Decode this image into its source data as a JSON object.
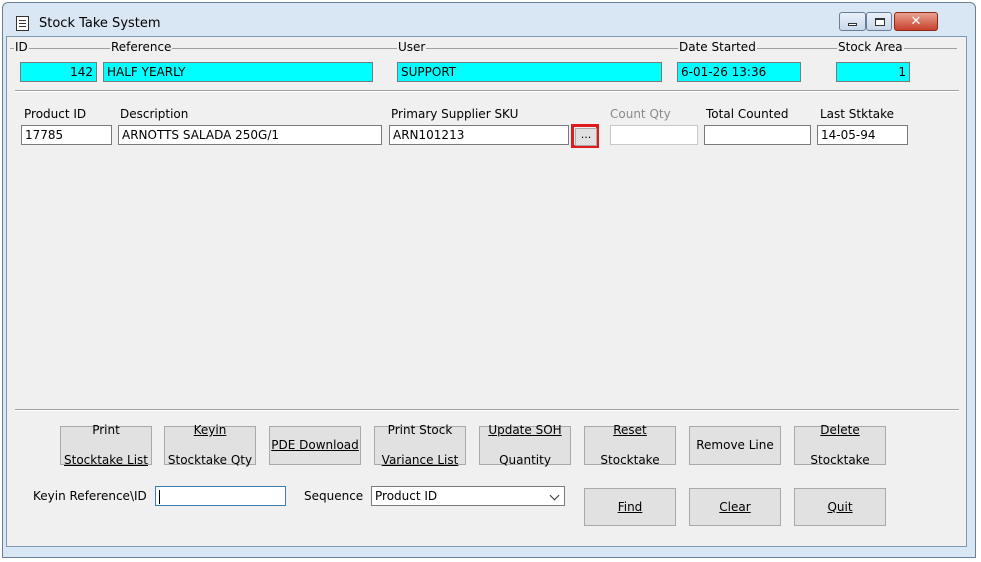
{
  "window": {
    "title": "Stock Take System"
  },
  "header": {
    "id_label": "ID",
    "id_value": "142",
    "reference_label": "Reference",
    "reference_value": "HALF YEARLY",
    "user_label": "User",
    "user_value": "SUPPORT",
    "date_label": "Date Started",
    "date_value": "6-01-26 13:36",
    "area_label": "Stock Area",
    "area_value": "1"
  },
  "line": {
    "product_id_label": "Product ID",
    "product_id_value": "17785",
    "description_label": "Description",
    "description_value": "ARNOTTS SALADA 250G/1",
    "sku_label": "Primary Supplier SKU",
    "sku_value": "ARN101213",
    "ellipsis_label": "...",
    "count_qty_label": "Count Qty",
    "count_qty_value": "",
    "total_counted_label": "Total Counted",
    "total_counted_value": "",
    "last_stktake_label": "Last Stktake",
    "last_stktake_value": "14-05-94"
  },
  "buttons": {
    "print_list_l1": "Print",
    "print_list_l2": "Stocktake List",
    "keyin_qty_l1": "Keyin",
    "keyin_qty_l2": "Stocktake Qty",
    "pde_download": "PDE Download",
    "print_variance_l1": "Print Stock",
    "print_variance_l2": "Variance List",
    "update_soh_l1": "Update SOH",
    "update_soh_l2": "Quantity",
    "reset_l1": "Reset",
    "reset_l2": "Stocktake",
    "remove_line": "Remove Line",
    "delete_l1": "Delete",
    "delete_l2": "Stocktake",
    "find": "Find",
    "clear": "Clear",
    "quit": "Quit"
  },
  "footer": {
    "keyin_ref_label": "Keyin Reference\\ID",
    "keyin_ref_value": "",
    "sequence_label": "Sequence",
    "sequence_value": "Product ID"
  },
  "colors": {
    "highlight_field": "#00ffff",
    "annotation_box": "#e01b1b"
  }
}
